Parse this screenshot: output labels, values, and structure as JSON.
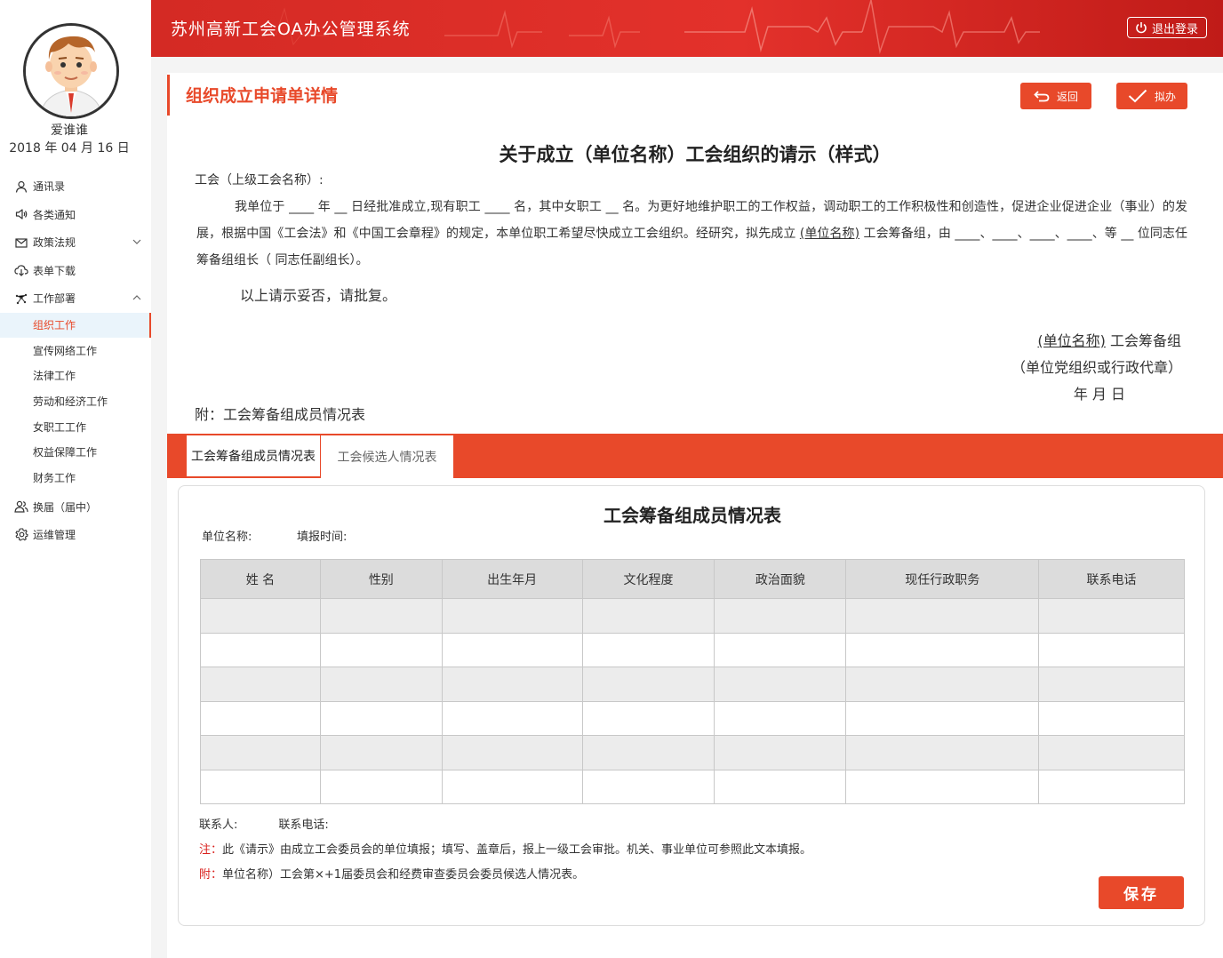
{
  "header": {
    "app_title": "苏州高新工会OA办公管理系统",
    "logout_label": "退出登录"
  },
  "user": {
    "name": "爱谁谁",
    "date": "2018 年 04 月 16 日"
  },
  "sidebar": {
    "items": [
      {
        "label": "通讯录",
        "icon": "user-icon"
      },
      {
        "label": "各类通知",
        "icon": "speaker-icon"
      },
      {
        "label": "政策法规",
        "icon": "envelope-icon",
        "chevron": "down"
      },
      {
        "label": "表单下载",
        "icon": "cloud-download-icon"
      },
      {
        "label": "工作部署",
        "icon": "network-icon",
        "chevron": "up"
      }
    ],
    "subitems": [
      {
        "label": "组织工作",
        "active": true
      },
      {
        "label": "宣传网络工作"
      },
      {
        "label": "法律工作"
      },
      {
        "label": "劳动和经济工作"
      },
      {
        "label": "女职工工作"
      },
      {
        "label": "权益保障工作"
      },
      {
        "label": "财务工作"
      }
    ],
    "bottom_items": [
      {
        "label": "换届（届中）",
        "icon": "users-icon"
      },
      {
        "label": "运维管理",
        "icon": "gear-icon"
      }
    ]
  },
  "page": {
    "title": "组织成立申请单详情",
    "back_label": "返回",
    "draft_label": "拟办"
  },
  "document": {
    "title": "关于成立（单位名称）工会组织的请示（样式）",
    "salutation": "工会（上级工会名称）:",
    "para_part1": "我单位于 ____ 年 __ 日经批准成立,现有职工 ____ 名，其中女职工 __ 名。为更好地维护职工的工作权益，调动职工的工作积极性和创造性，促进企业促进企业（事业）的发展，根据中国《工会法》和《中国工会章程》的规定，本单位职工希望尽快成立工会组织。经研究，拟先成立 ",
    "para_unit": "(单位名称)",
    "para_part2": " 工会筹备组，由 ____、____、____、____、等 __ 位同志任筹备组组长（ 同志任副组长）。",
    "closing": "以上请示妥否，请批复。",
    "sig_unit": "(单位名称)",
    "sig_unit_suffix": " 工会筹备组",
    "sig_seal": "（单位党组织或行政代章）",
    "sig_date": "年 月 日",
    "attachment": "附：工会筹备组成员情况表"
  },
  "tabs": [
    {
      "label": "工会筹备组成员情况表",
      "active": true
    },
    {
      "label": "工会候选人情况表"
    }
  ],
  "form": {
    "title": "工会筹备组成员情况表",
    "unit_label": "单位名称:",
    "time_label": "填报时间:",
    "columns": [
      "姓 名",
      "性别",
      "出生年月",
      "文化程度",
      "政治面貌",
      "现任行政职务",
      "联系电话"
    ],
    "contact_person_label": "联系人:",
    "contact_phone_label": "联系电话:",
    "note_tag": "注：",
    "note_text": "此《请示》由成立工会委员会的单位填报；填写、盖章后，报上一级工会审批。机关、事业单位可参照此文本填报。",
    "attach_tag": "附：",
    "attach_text": "单位名称）工会第×+1届委员会和经费审查委员会委员候选人情况表。",
    "save_label": "保存"
  },
  "colors": {
    "brand_red": "#d9201d",
    "accent_orange": "#e8492a",
    "active_bg": "#eaf4fb"
  }
}
